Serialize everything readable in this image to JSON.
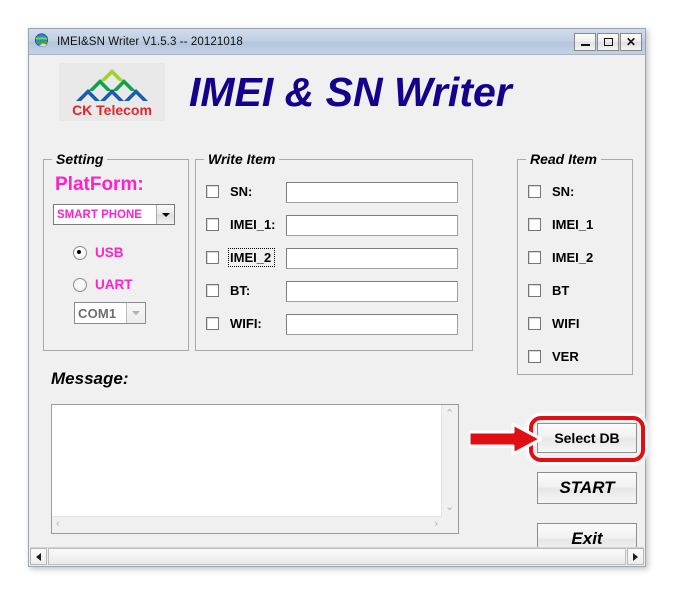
{
  "window": {
    "title": "IMEI&SN Writer V1.5.3 -- 20121018",
    "icon": "globe-icon",
    "controls": {
      "minimize": "_",
      "maximize": "□",
      "close": "✕"
    }
  },
  "banner": {
    "logo_text": "CK Telecom",
    "logo_colors": {
      "top": "#a4d129",
      "middle": "#12a14b",
      "bottom": "#1b5cae",
      "text": "#e8232a"
    },
    "app_title": "IMEI & SN Writer",
    "app_title_color": "#13008c"
  },
  "setting": {
    "group_title": "Setting",
    "platform_label": "PlatForm:",
    "platform_color": "#ff22cc",
    "platform_value": "SMART PHONE",
    "radios": [
      {
        "label": "USB",
        "checked": true
      },
      {
        "label": "UART",
        "checked": false
      }
    ],
    "com_port_value": "COM1",
    "com_port_enabled": false
  },
  "write_item": {
    "group_title": "Write Item",
    "rows": [
      {
        "label": "SN:",
        "checked": false,
        "value": "",
        "focused": false
      },
      {
        "label": "IMEI_1:",
        "checked": false,
        "value": "",
        "focused": false
      },
      {
        "label": "IMEI_2",
        "checked": false,
        "value": "",
        "focused": true
      },
      {
        "label": "BT:",
        "checked": false,
        "value": "",
        "focused": false
      },
      {
        "label": "WIFI:",
        "checked": false,
        "value": "",
        "focused": false
      }
    ]
  },
  "read_item": {
    "group_title": "Read Item",
    "rows": [
      {
        "label": "SN:",
        "checked": false
      },
      {
        "label": "IMEI_1",
        "checked": false
      },
      {
        "label": "IMEI_2",
        "checked": false
      },
      {
        "label": "BT",
        "checked": false
      },
      {
        "label": "WIFI",
        "checked": false
      },
      {
        "label": "VER",
        "checked": false
      }
    ]
  },
  "message": {
    "label": "Message:",
    "value": ""
  },
  "buttons": {
    "select_db": "Select DB",
    "start": "START",
    "exit": "Exit"
  },
  "annotation": {
    "color": "#e10f14",
    "target": "Select DB"
  }
}
